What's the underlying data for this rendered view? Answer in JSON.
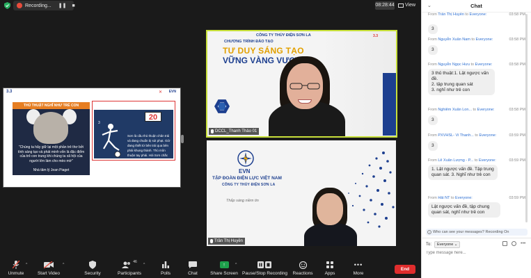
{
  "topbar": {
    "recording_label": "Recording...",
    "pause_icon": "pause-icon",
    "stop_icon": "stop-icon",
    "timer": "08:28:44",
    "view_label": "View"
  },
  "share": {
    "logo_text": "3.3",
    "evn_text": "EVN",
    "slide_left_heading": "THỦ THUẬT NGHĨ NHƯ TRẺ CON",
    "quote": "\"Chúng ta hãy giữ lại một phần trẻ thơ bởi tính sáng tạo và phát minh vốn là đặc điểm của trẻ con trung khi chúng ta xã hội của người lớn làm cho mèo mờ\"",
    "quote_author": "Nhà tâm lý Jean Piaget",
    "slide_right_number": "3",
    "slide_right_badge": "20",
    "slide_right_text": "Sơn là cầu thủ thuận chân trái và đang chuẩn bị sút phạt. Giờ đang thiết từ bên trái qua bên phải khung thành. Thủ môn thuận tay phải. Hỏi Sơn chắc chắn sẽ sút vào đâu?"
  },
  "tile1": {
    "company": "CÔNG TY THỦY ĐIỆN SƠN LA",
    "program": "CHƯƠNG TRÌNH ĐÀO TẠO",
    "title_line1": "TƯ DUY SÁNG TẠO",
    "title_line2": "VỮNG VÀNG VƯỢT R",
    "corner_text": "3.3",
    "name": "DCCL_Thanh Thảo 01"
  },
  "tile2": {
    "evn": "EVN",
    "group": "TẬP ĐOÀN ĐIỆN LỰC VIỆT NAM",
    "company": "CÔNG TY THỦY ĐIỆN SƠN LA",
    "slogan": "Thắp sáng niềm tin",
    "name": "Trần Thị Huyền"
  },
  "toolbar": {
    "unmute": "Unmute",
    "start_video": "Start Video",
    "security": "Security",
    "participants": "Participants",
    "participants_count": "46",
    "polls": "Polls",
    "chat": "Chat",
    "share_screen": "Share Screen",
    "record": "Pause/Stop Recording",
    "reactions": "Reactions",
    "apps": "Apps",
    "more": "More",
    "end": "End"
  },
  "chat": {
    "title": "Chat",
    "messages": [
      {
        "from": "From",
        "name": "Trần Thị Huyền",
        "to": "to",
        "target": "Everyone:",
        "time": "03:58 PM",
        "text": ""
      },
      {
        "from": "",
        "name": "",
        "to": "",
        "target": "",
        "time": "",
        "text": "3"
      },
      {
        "from": "From",
        "name": "Nguyễn Xuân Nam",
        "to": "to",
        "target": "Everyone:",
        "time": "03:58 PM",
        "text": "3"
      },
      {
        "from": "From",
        "name": "Nguyễn Ngọc Hưu",
        "to": "to",
        "target": "Everyone:",
        "time": "03:58 PM",
        "text": "3 thủ thuật:1. Lật ngược vấn đề.\n2. tập trung quan sát\n3. nghĩ như trẻ con"
      },
      {
        "from": "From",
        "name": "Nghiêm Xuân Lon...",
        "to": "to",
        "target": "Everyone:",
        "time": "03:58 PM",
        "text": "3"
      },
      {
        "from": "From",
        "name": "PXVHSL- Vi Thanh...",
        "to": "to",
        "target": "Everyone:",
        "time": "03:59 PM",
        "text": "3"
      },
      {
        "from": "From",
        "name": "Lê Xuân Lượng - P...",
        "to": "to",
        "target": "Everyone:",
        "time": "03:59 PM",
        "text": "1. Lật ngược vấn đề. Tập trung quan sát. 3. Nghĩ như trẻ con"
      },
      {
        "from": "From",
        "name": "Hải NT",
        "to": "to",
        "target": "Everyone:",
        "time": "03:59 PM",
        "text": "Lật ngược vấn đề, tập chung quan sát, nghĩ như trẻ con"
      }
    ],
    "privacy": "Who can see your messages? Recording On",
    "to_label": "To:",
    "to_value": "Everyone",
    "input_placeholder": "Type message here..."
  }
}
